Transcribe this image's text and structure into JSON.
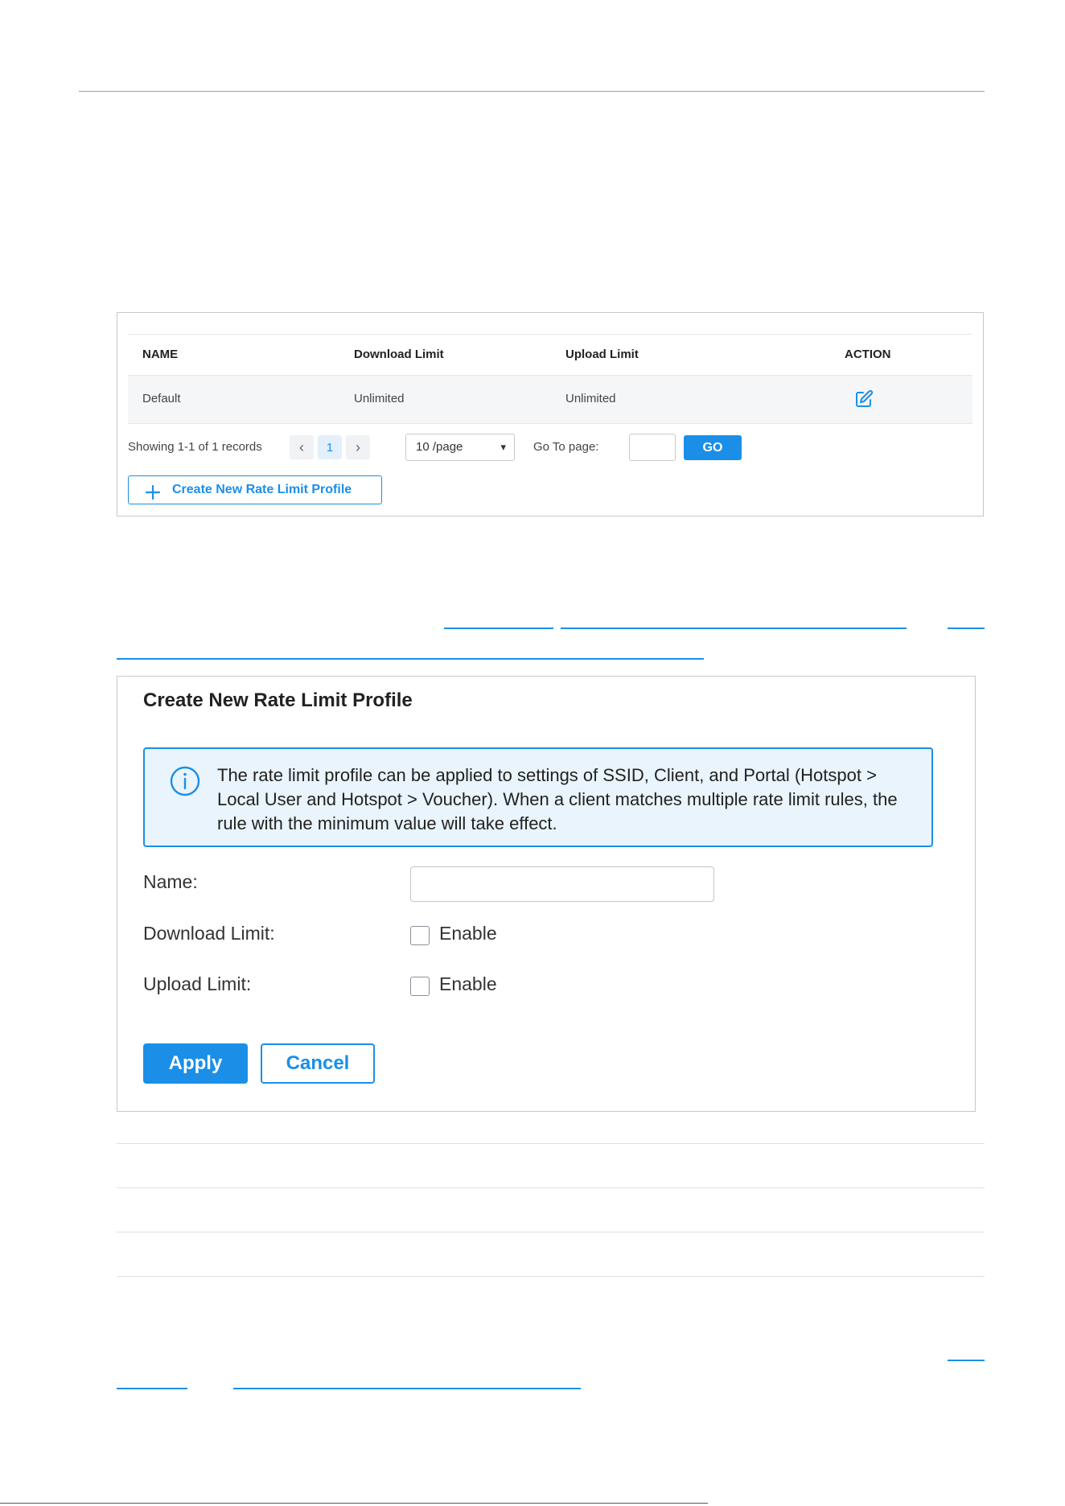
{
  "table": {
    "headers": [
      "NAME",
      "Download Limit",
      "Upload Limit",
      "ACTION"
    ],
    "rows": [
      {
        "name": "Default",
        "download": "Unlimited",
        "upload": "Unlimited",
        "action_icon": "edit-icon"
      }
    ]
  },
  "pagination": {
    "summary": "Showing 1-1 of 1 records",
    "prev": "‹",
    "current_page": "1",
    "next": "›",
    "page_size": "10 /page",
    "goto_label": "Go To page:",
    "goto_value": "",
    "go_label": "GO"
  },
  "create_button": {
    "label": "Create New Rate Limit Profile",
    "icon": "plus-icon"
  },
  "dialog": {
    "title": "Create New Rate Limit Profile",
    "info_icon": "info-icon",
    "info_text": "The rate limit profile can be applied to settings of SSID, Client, and Portal (Hotspot > Local User and Hotspot > Voucher). When a client matches multiple rate limit rules, the rule with the minimum value will take effect.",
    "fields": {
      "name_label": "Name:",
      "name_value": "",
      "download_label": "Download Limit:",
      "download_checkbox": "Enable",
      "upload_label": "Upload Limit:",
      "upload_checkbox": "Enable"
    },
    "apply_label": "Apply",
    "cancel_label": "Cancel"
  },
  "colors": {
    "accent": "#1b8fe8",
    "info_bg": "#e9f4fc",
    "row_bg": "#f5f6f8",
    "border": "#c9c9c9"
  }
}
